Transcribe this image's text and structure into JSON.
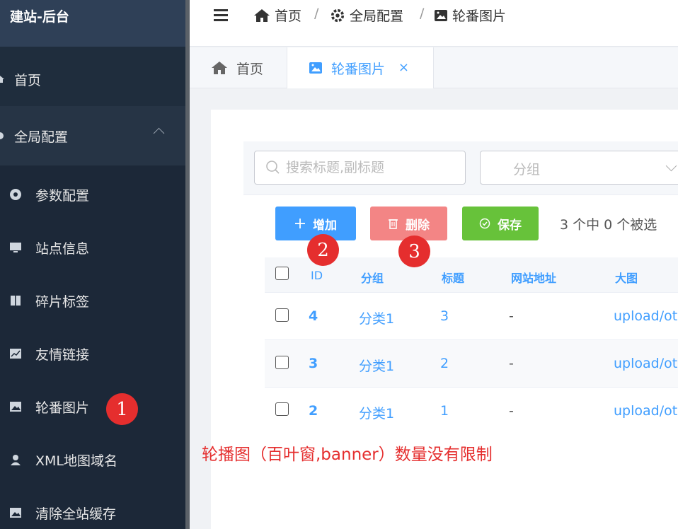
{
  "sidebar": {
    "brand": "建站-后台",
    "home": "首页",
    "global_config": "全局配置",
    "items": [
      {
        "label": "参数配置",
        "icon": "gear-icon"
      },
      {
        "label": "站点信息",
        "icon": "monitor-icon"
      },
      {
        "label": "碎片标签",
        "icon": "book-icon"
      },
      {
        "label": "友情链接",
        "icon": "chart-icon"
      },
      {
        "label": "轮番图片",
        "icon": "image-icon"
      },
      {
        "label": "XML地图域名",
        "icon": "user-icon"
      },
      {
        "label": "清除全站缓存",
        "icon": "image-icon"
      }
    ]
  },
  "breadcrumb": [
    "首页",
    "全局配置",
    "轮番图片"
  ],
  "tabs": [
    {
      "label": "首页"
    },
    {
      "label": "轮番图片",
      "close": "×"
    }
  ],
  "filter": {
    "search_placeholder": "搜索标题,副标题",
    "group_placeholder": "分组"
  },
  "toolbar": {
    "add_label": "增加",
    "delete_label": "删除",
    "save_label": "保存",
    "selection_text": "3 个中 0 个被选"
  },
  "table": {
    "columns": [
      "ID",
      "分组",
      "标题",
      "网站地址",
      "大图"
    ],
    "rows": [
      {
        "id": "4",
        "group": "分类1",
        "title": "3",
        "url": "-",
        "image": "upload/oth"
      },
      {
        "id": "3",
        "group": "分类1",
        "title": "2",
        "url": "-",
        "image": "upload/oth"
      },
      {
        "id": "2",
        "group": "分类1",
        "title": "1",
        "url": "-",
        "image": "upload/oth"
      }
    ]
  },
  "annotations": {
    "badges": [
      "1",
      "2",
      "3"
    ],
    "note": "轮播图（百叶窗,banner）数量没有限制"
  },
  "colors": {
    "primary": "#409eff",
    "danger": "#f38585",
    "success": "#67c23a",
    "annotation_red": "#e52e2e",
    "sidebar_bg": "#1f2d3d"
  }
}
